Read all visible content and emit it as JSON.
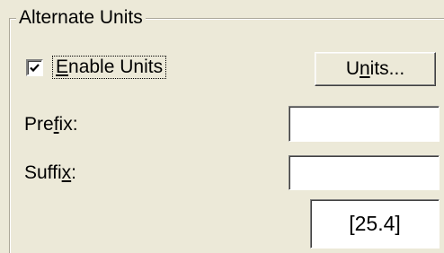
{
  "group": {
    "title": "Alternate Units"
  },
  "enable_units": {
    "label_mnemonic": "E",
    "label_rest": "nable Units",
    "checked": true
  },
  "units_button": {
    "label_before": "U",
    "label_mnemonic": "n",
    "label_after": "its..."
  },
  "prefix": {
    "label_before": "Pre",
    "label_mnemonic": "f",
    "label_after": "ix:",
    "value": ""
  },
  "suffix": {
    "label_before": "Suffi",
    "label_mnemonic": "x",
    "label_after": ":",
    "value": ""
  },
  "preview": {
    "text": "[25.4]"
  },
  "icons": {
    "checkmark": "checkmark-icon"
  }
}
